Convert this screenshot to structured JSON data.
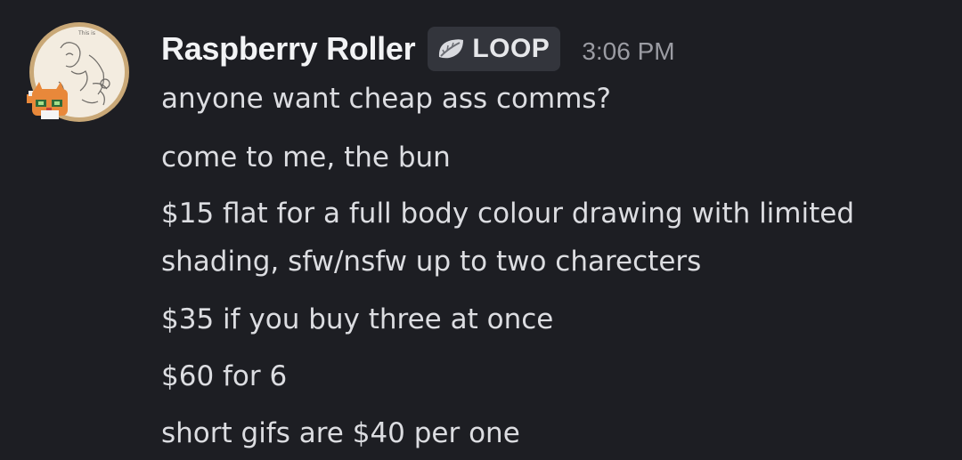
{
  "message": {
    "author": "Raspberry Roller",
    "tag": {
      "label": "LOOP",
      "icon": "leaf-icon"
    },
    "timestamp": "3:06 PM",
    "avatar": {
      "sketch_text": "This is"
    },
    "lines": [
      "anyone want cheap ass comms?",
      "come to me, the bun",
      "$15 flat for a full body colour drawing with limited shading, sfw/nsfw up to two charecters",
      "$35 if you buy three at once",
      "$60 for 6",
      "short gifs are $40 per one"
    ]
  },
  "colors": {
    "background": "#1d1e23",
    "username": "#f2f3f5",
    "text": "#dcdde1",
    "timestamp": "#9b9ca3",
    "tag_background": "#33353c",
    "avatar_frame": "#c9a877",
    "cat": "#e8883a"
  }
}
